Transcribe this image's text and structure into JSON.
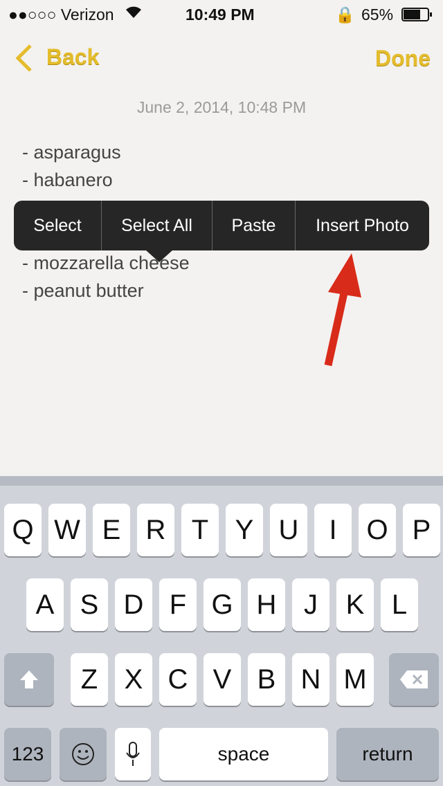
{
  "status": {
    "carrier": "●●○○○ Verizon",
    "time": "10:49 PM",
    "battery": "65%",
    "icons": [
      "wifi-icon",
      "rotation-lock-icon",
      "battery-icon"
    ]
  },
  "nav": {
    "back": "Back",
    "done": "Done",
    "accent": "#e4bc2c"
  },
  "note": {
    "date": "June 2, 2014, 10:48 PM",
    "lines": [
      "- asparagus",
      "- habanero",
      "- mozzarella cheese",
      "- peanut butter"
    ]
  },
  "menu": {
    "items": [
      "Select",
      "Select All",
      "Paste",
      "Insert Photo"
    ]
  },
  "keyboard": {
    "row1": [
      "Q",
      "W",
      "E",
      "R",
      "T",
      "Y",
      "U",
      "I",
      "O",
      "P"
    ],
    "row2": [
      "A",
      "S",
      "D",
      "F",
      "G",
      "H",
      "J",
      "K",
      "L"
    ],
    "row3": [
      "Z",
      "X",
      "C",
      "V",
      "B",
      "N",
      "M"
    ],
    "numbers": "123",
    "space": "space",
    "return": "return"
  }
}
